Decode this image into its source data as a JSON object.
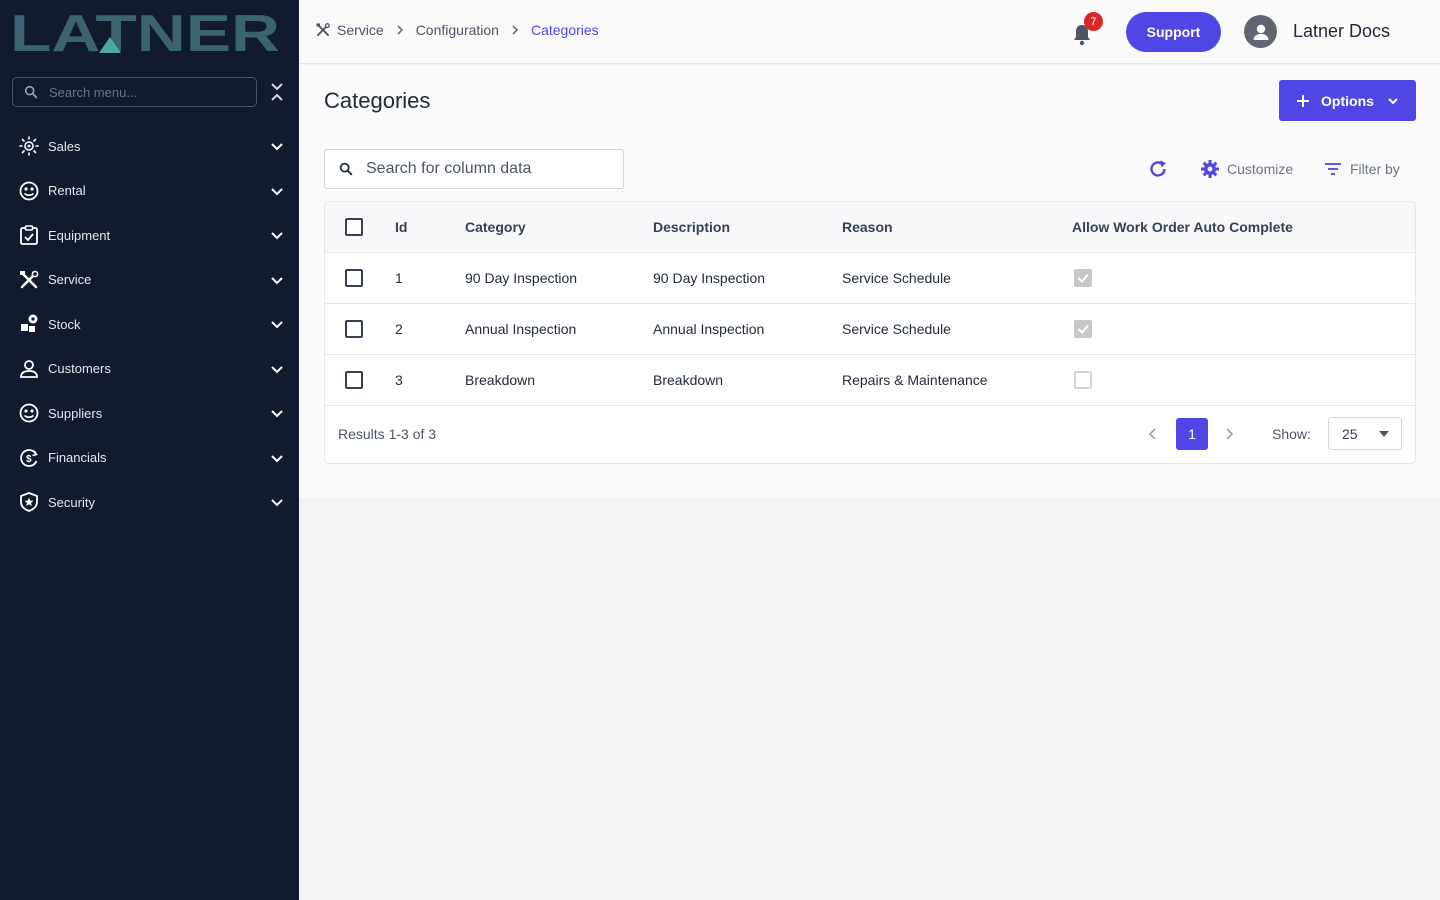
{
  "brand": {
    "logo_text": "LATNER"
  },
  "sidebar": {
    "search_placeholder": "Search menu...",
    "items": [
      {
        "label": "Sales",
        "icon": "sales-icon"
      },
      {
        "label": "Rental",
        "icon": "rental-icon"
      },
      {
        "label": "Equipment",
        "icon": "equipment-icon"
      },
      {
        "label": "Service",
        "icon": "service-icon"
      },
      {
        "label": "Stock",
        "icon": "stock-icon"
      },
      {
        "label": "Customers",
        "icon": "customers-icon"
      },
      {
        "label": "Suppliers",
        "icon": "suppliers-icon"
      },
      {
        "label": "Financials",
        "icon": "financials-icon"
      },
      {
        "label": "Security",
        "icon": "security-icon"
      }
    ]
  },
  "header": {
    "breadcrumb": [
      "Service",
      "Configuration",
      "Categories"
    ],
    "notification_count": "7",
    "support_label": "Support",
    "user_name": "Latner Docs"
  },
  "page": {
    "title": "Categories",
    "options_label": "Options",
    "search_placeholder": "Search for column data",
    "customize_label": "Customize",
    "filter_label": "Filter by"
  },
  "table": {
    "columns": [
      "Id",
      "Category",
      "Description",
      "Reason",
      "Allow Work Order Auto Complete"
    ],
    "rows": [
      {
        "id": "1",
        "category": "90 Day Inspection",
        "description": "90 Day Inspection",
        "reason": "Service Schedule",
        "auto_complete": true
      },
      {
        "id": "2",
        "category": "Annual Inspection",
        "description": "Annual Inspection",
        "reason": "Service Schedule",
        "auto_complete": true
      },
      {
        "id": "3",
        "category": "Breakdown",
        "description": "Breakdown",
        "reason": "Repairs & Maintenance",
        "auto_complete": false
      }
    ]
  },
  "pagination": {
    "results_text": "Results 1-3 of 3",
    "current_page": "1",
    "show_label": "Show:",
    "page_size": "25"
  },
  "colors": {
    "accent": "#4f46e5",
    "sidebar_bg": "#121a2e",
    "logo": "#3a6472",
    "badge": "#dc2626"
  }
}
